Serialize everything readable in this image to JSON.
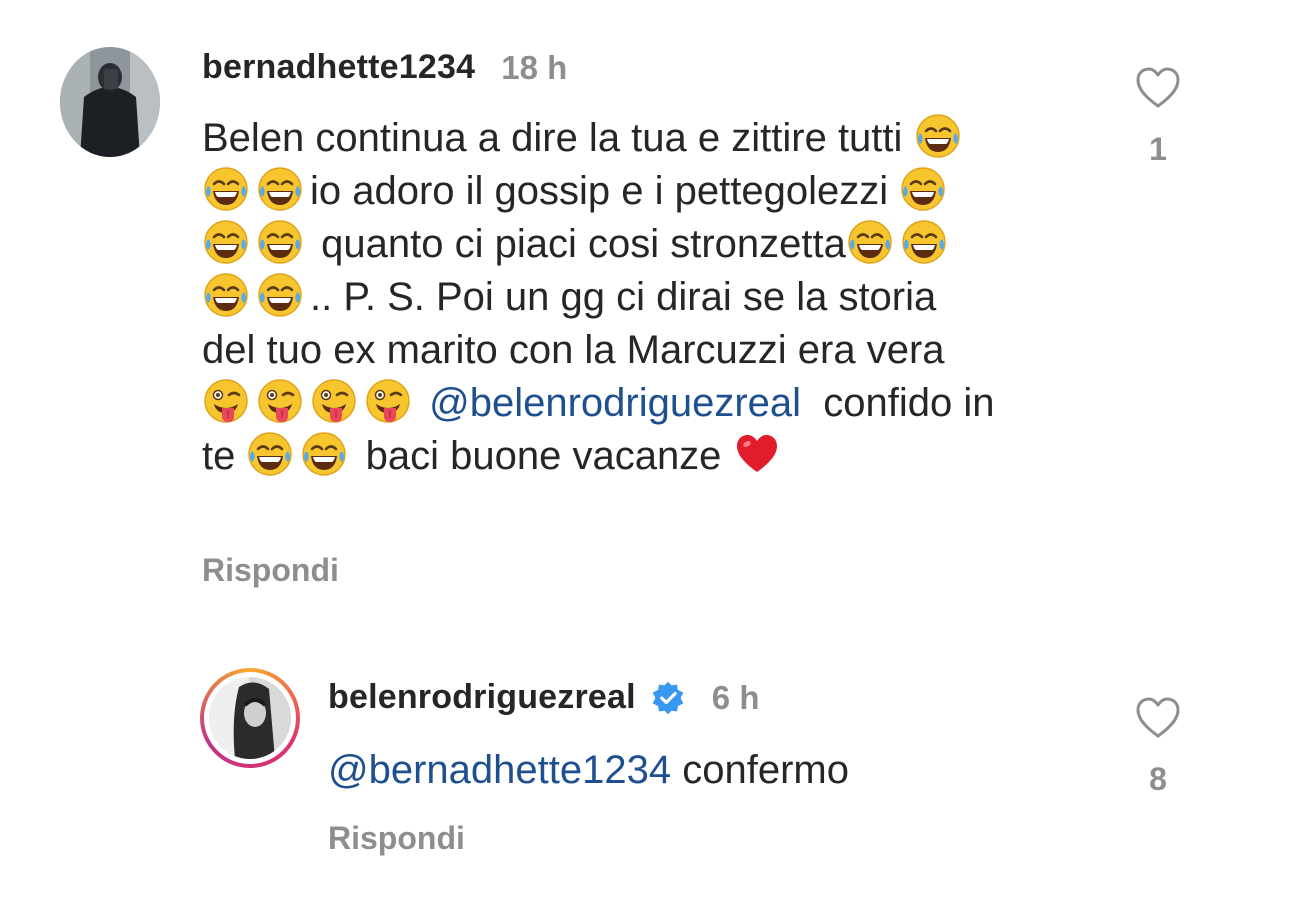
{
  "comments": [
    {
      "username": "bernadhette1234",
      "time": "18 h",
      "likes": "1",
      "reply_label": "Rispondi",
      "text": {
        "l1": "Belen continua a dire la tua e zittire tutti",
        "l2": "io adoro il gossip e i pettegolezzi",
        "l3": "quanto ci piaci cosi stronzetta",
        "l4": ".. P. S. Poi un gg ci dirai se la storia",
        "l5": "del tuo ex marito con la Marcuzzi era vera",
        "l6_mention": "@belenrodriguezreal",
        "l6_rest": "confido in",
        "l7_start": "te",
        "l7_rest": "baci buone vacanze"
      },
      "icons": {
        "laugh": "face-with-tears-of-joy-icon",
        "tongue": "winking-face-with-tongue-icon",
        "heart": "red-heart-icon"
      }
    },
    {
      "username": "belenrodriguezreal",
      "verified": true,
      "time": "6 h",
      "likes": "8",
      "reply_label": "Rispondi",
      "mention": "@bernadhette1234",
      "text": "confermo"
    }
  ],
  "colors": {
    "text": "#262626",
    "muted": "#8e8e8e",
    "mention": "#1e4f8f",
    "verified": "#3897f0"
  }
}
